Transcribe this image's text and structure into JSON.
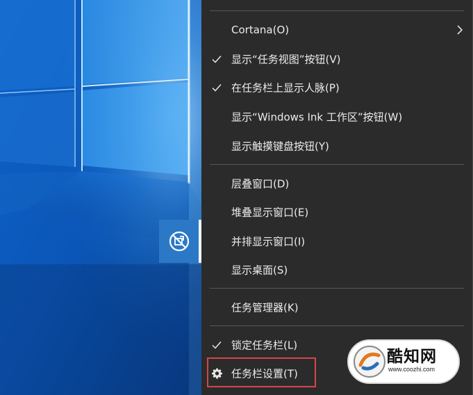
{
  "menu": {
    "items": [
      {
        "label": "Cortana(O)",
        "checked": false,
        "submenu": true
      },
      {
        "label": "显示“任务视图”按钮(V)",
        "checked": true
      },
      {
        "label": "在任务栏上显示人脉(P)",
        "checked": true
      },
      {
        "label": "显示“Windows Ink 工作区”按钮(W)",
        "checked": false
      },
      {
        "label": "显示触摸键盘按钮(Y)",
        "checked": false
      },
      {
        "label": "层叠窗口(D)"
      },
      {
        "label": "堆叠显示窗口(E)"
      },
      {
        "label": "并排显示窗口(I)"
      },
      {
        "label": "显示桌面(S)"
      },
      {
        "label": "任务管理器(K)"
      },
      {
        "label": "锁定任务栏(L)",
        "checked": true
      },
      {
        "label": "任务栏设置(T)",
        "icon": "gear-icon",
        "highlighted": true
      }
    ]
  },
  "taskbar": {
    "app_icon": "people-off-icon"
  },
  "watermark": {
    "title": "酷知网",
    "subtitle": "www.coozhi.com"
  },
  "colors": {
    "menu_bg": "#2b2b2b",
    "menu_text": "#ececec",
    "separator": "#575757",
    "highlight_border": "#d84548",
    "wallpaper_blue": "#0b5ec2"
  }
}
